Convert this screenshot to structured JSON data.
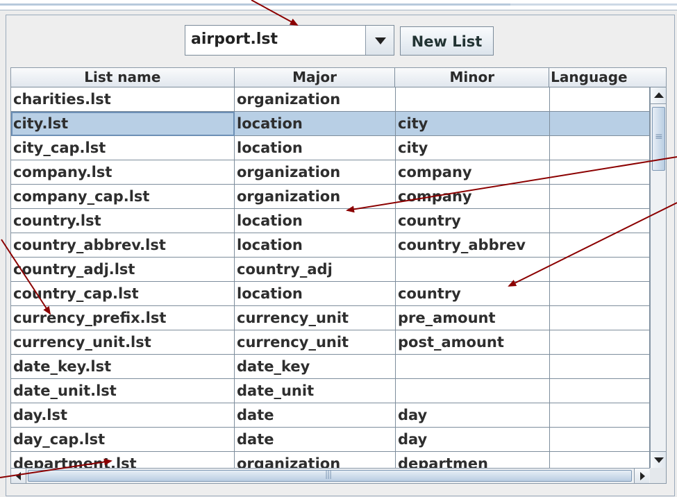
{
  "combo": {
    "selected": "airport.lst"
  },
  "toolbar": {
    "new_list_label": "New List"
  },
  "table": {
    "columns": [
      "List name",
      "Major",
      "Minor",
      "Language"
    ],
    "rows": [
      [
        "charities.lst",
        "organization",
        "",
        ""
      ],
      [
        "city.lst",
        "location",
        "city",
        ""
      ],
      [
        "city_cap.lst",
        "location",
        "city",
        ""
      ],
      [
        "company.lst",
        "organization",
        "company",
        ""
      ],
      [
        "company_cap.lst",
        "organization",
        "company",
        ""
      ],
      [
        "country.lst",
        "location",
        "country",
        ""
      ],
      [
        "country_abbrev.lst",
        "location",
        "country_abbrev",
        ""
      ],
      [
        "country_adj.lst",
        "country_adj",
        "",
        ""
      ],
      [
        "country_cap.lst",
        "location",
        "country",
        ""
      ],
      [
        "currency_prefix.lst",
        "currency_unit",
        "pre_amount",
        ""
      ],
      [
        "currency_unit.lst",
        "currency_unit",
        "post_amount",
        ""
      ],
      [
        "date_key.lst",
        "date_key",
        "",
        ""
      ],
      [
        "date_unit.lst",
        "date_unit",
        "",
        ""
      ],
      [
        "day.lst",
        "date",
        "day",
        ""
      ],
      [
        "day_cap.lst",
        "date",
        "day",
        ""
      ],
      [
        "department.lst",
        "organization",
        "departmen",
        ""
      ]
    ],
    "selected_row": 1
  },
  "colors": {
    "selection": "#b8cfe5",
    "annotation_arrow": "#8b0000"
  }
}
